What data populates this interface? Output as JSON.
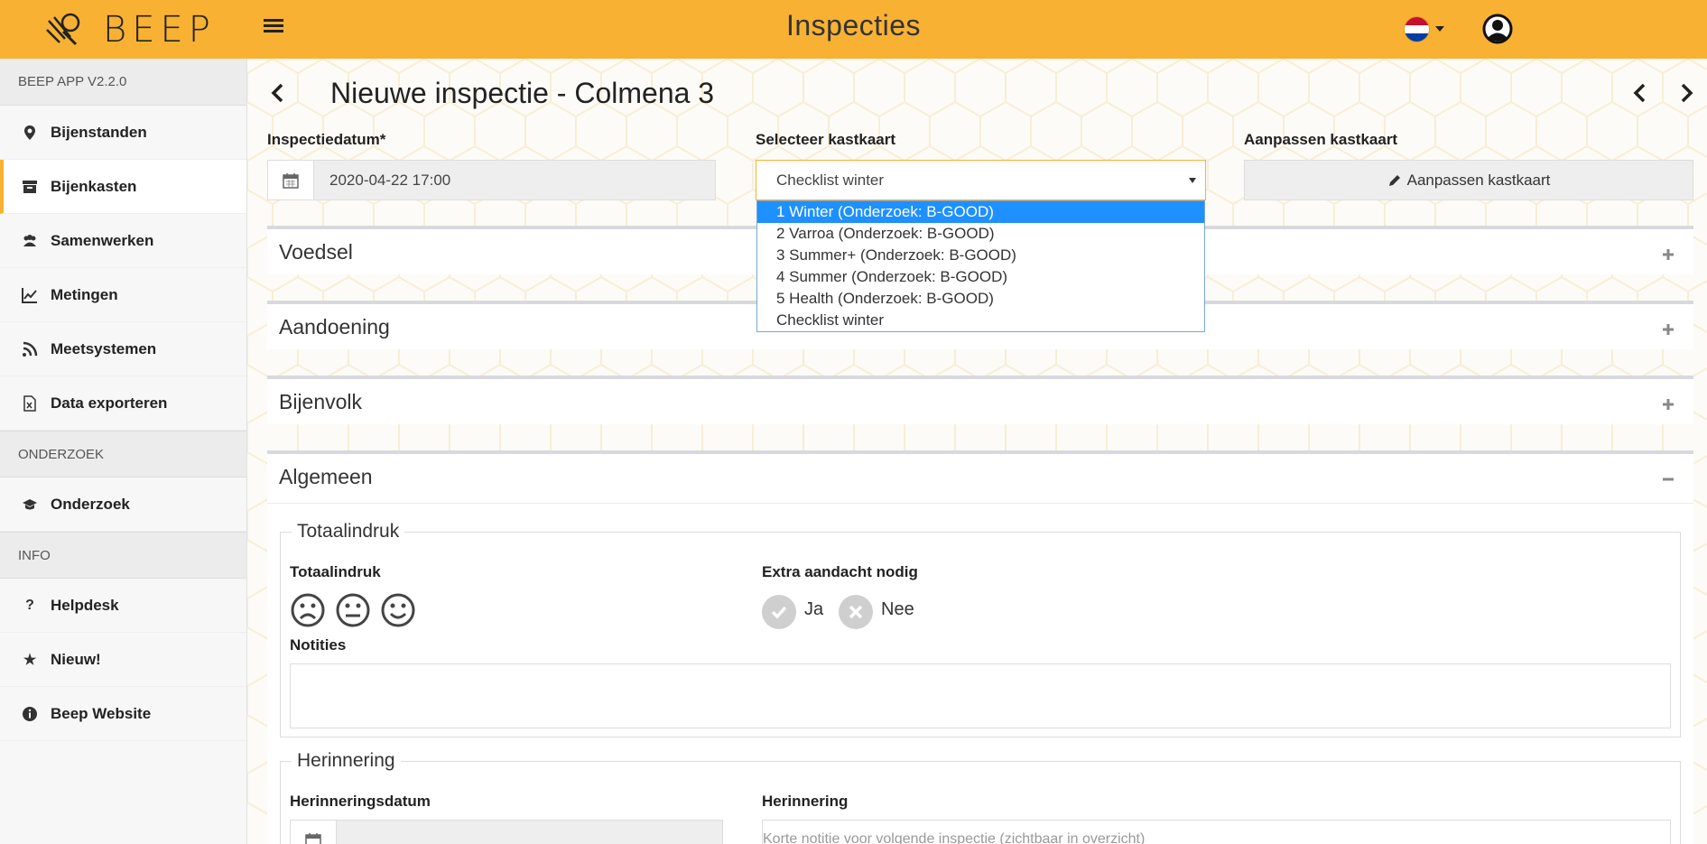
{
  "app": {
    "brand": "BEEP",
    "title": "Inspecties"
  },
  "sidebar": {
    "version": "BEEP APP V2.2.0",
    "items_main": [
      {
        "label": "Bijenstanden",
        "icon": "map-marker-icon"
      },
      {
        "label": "Bijenkasten",
        "icon": "archive-icon"
      },
      {
        "label": "Samenwerken",
        "icon": "users-icon"
      },
      {
        "label": "Metingen",
        "icon": "line-chart-icon"
      },
      {
        "label": "Meetsystemen",
        "icon": "rss-icon"
      },
      {
        "label": "Data exporteren",
        "icon": "file-excel-icon"
      }
    ],
    "section_research": "ONDERZOEK",
    "research_item": "Onderzoek",
    "section_info": "INFO",
    "info_items": [
      {
        "label": "Helpdesk",
        "icon": "question-icon"
      },
      {
        "label": "Nieuw!",
        "icon": "star-icon"
      },
      {
        "label": "Beep Website",
        "icon": "info-circle-icon"
      }
    ]
  },
  "page": {
    "title": "Nieuwe inspectie - Colmena 3"
  },
  "form": {
    "date_label": "Inspectiedatum*",
    "date_value": "2020-04-22 17:00",
    "select_label": "Selecteer kastkaart",
    "select_value": "Checklist winter",
    "options": [
      "1 Winter (Onderzoek: B-GOOD)",
      "2 Varroa (Onderzoek: B-GOOD)",
      "3 Summer+ (Onderzoek: B-GOOD)",
      "4 Summer (Onderzoek: B-GOOD)",
      "5 Health (Onderzoek: B-GOOD)",
      "Checklist winter"
    ],
    "edit_label": "Aanpassen kastkaart",
    "edit_button": "Aanpassen kastkaart"
  },
  "panels": {
    "voedsel": "Voedsel",
    "aandoening": "Aandoening",
    "bijenvolk": "Bijenvolk",
    "algemeen": "Algemeen"
  },
  "algemeen": {
    "fieldset_title": "Totaalindruk",
    "impression_label": "Totaalindruk",
    "attention_label": "Extra aandacht nodig",
    "yes": "Ja",
    "no": "Nee",
    "notes_label": "Notities",
    "reminder_title": "Herinnering",
    "reminder_date_label": "Herinneringsdatum",
    "reminder_label": "Herinnering",
    "reminder_placeholder": "Korte notitie voor volgende inspectie (zichtbaar in overzicht)"
  },
  "colors": {
    "accent": "#f8b133",
    "select_highlight": "#1e90ff"
  }
}
